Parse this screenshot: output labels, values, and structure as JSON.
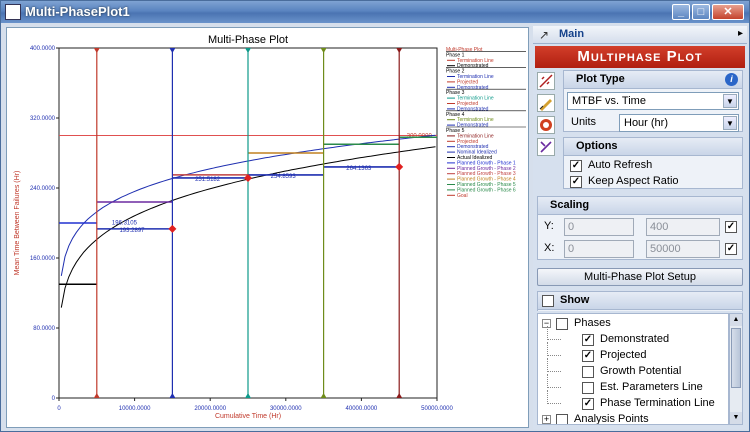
{
  "window": {
    "title": "Multi-PhasePlot1",
    "buttons": [
      "_",
      "□",
      "✕"
    ]
  },
  "panel": {
    "header": "Main",
    "banner": "Multiphase Plot",
    "plot_type": {
      "title": "Plot Type",
      "value": "MTBF vs. Time",
      "units_label": "Units",
      "units_value": "Hour (hr)"
    },
    "options": {
      "title": "Options",
      "items": [
        {
          "label": "Auto Refresh",
          "checked": true
        },
        {
          "label": "Keep Aspect Ratio",
          "checked": true
        }
      ]
    },
    "scaling": {
      "title": "Scaling",
      "y": {
        "label": "Y:",
        "min": "0",
        "max": "400",
        "checked": true
      },
      "x": {
        "label": "X:",
        "min": "0",
        "max": "50000",
        "checked": true
      }
    },
    "setup_button": "Multi-Phase Plot Setup",
    "show": {
      "title": "Show",
      "tree": [
        {
          "label": "Phases",
          "level": 0,
          "expander": "−",
          "checked": false
        },
        {
          "label": "Demonstrated",
          "level": 1,
          "checked": true
        },
        {
          "label": "Projected",
          "level": 1,
          "checked": true
        },
        {
          "label": "Growth Potential",
          "level": 1,
          "checked": false
        },
        {
          "label": "Est. Parameters Line",
          "level": 1,
          "checked": false
        },
        {
          "label": "Phase Termination Line",
          "level": 1,
          "checked": true
        },
        {
          "label": "Analysis Points",
          "level": 0,
          "expander": "+",
          "checked": false
        }
      ]
    }
  },
  "chart_data": {
    "type": "line",
    "title": "Multi-Phase Plot",
    "xlabel": "Cumulative Time (Hr)",
    "ylabel": "Mean Time Between Failures (Hr)",
    "xlim": [
      0,
      50000
    ],
    "ylim": [
      0,
      400
    ],
    "x_ticks": [
      "0",
      "10000.0000",
      "20000.0000",
      "30000.0000",
      "40000.0000",
      "50000.0000"
    ],
    "y_ticks": [
      "0",
      "80.0000",
      "160.0000",
      "240.0000",
      "320.0000",
      "400.0000"
    ],
    "goal": 300,
    "goal_label": "300.0000",
    "phase_terminations": [
      {
        "x": 5000,
        "color": "#c0392b"
      },
      {
        "x": 15000,
        "color": "#1f2fb0"
      },
      {
        "x": 25000,
        "color": "#0e9a8a"
      },
      {
        "x": 35000,
        "color": "#6e8c1a"
      },
      {
        "x": 45000,
        "color": "#8b1a1a"
      }
    ],
    "demonstrated": [
      {
        "x0": 0,
        "x1": 5000,
        "y": 130,
        "color": "#000000"
      },
      {
        "x0": 5000,
        "x1": 15000,
        "y": 193.3,
        "label": "193.2897",
        "color": "#1f2fb0"
      },
      {
        "x0": 15000,
        "x1": 25000,
        "y": 251.5,
        "label": "251.5182",
        "color": "#1f2fb0"
      },
      {
        "x0": 25000,
        "x1": 35000,
        "y": 254.9,
        "label": "254.8593",
        "color": "#1f2fb0"
      },
      {
        "x0": 35000,
        "x1": 45000,
        "y": 264.1,
        "label": "264.1363",
        "color": "#1f2fb0"
      }
    ],
    "planned_steps": [
      {
        "x0": 0,
        "x1": 5000,
        "y": 200,
        "color": "#2030d0"
      },
      {
        "x0": 5000,
        "x1": 15000,
        "y": 224,
        "color": "#6b2aa0"
      },
      {
        "x0": 15000,
        "x1": 25000,
        "y": 255,
        "color": "#c04040"
      },
      {
        "x0": 25000,
        "x1": 35000,
        "y": 280,
        "color": "#c08020"
      },
      {
        "x0": 35000,
        "x1": 45000,
        "y": 290,
        "color": "#2a8a4a"
      },
      {
        "x0": 45000,
        "x1": 50000,
        "y": 298,
        "color": "#2a8a4a"
      }
    ],
    "demo_label_extra": "196.3105",
    "projected_points": [
      {
        "x": 15000,
        "y": 193.3
      },
      {
        "x": 25000,
        "y": 251.5
      },
      {
        "x": 45000,
        "y": 264.1
      }
    ],
    "legend": [
      {
        "text": "Multi-Phase Plot",
        "color": "#c0392b"
      },
      {
        "text": "Phase 1",
        "color": "#000000"
      },
      {
        "text": "Termination Line",
        "color": "#c0392b"
      },
      {
        "text": "Demonstrated",
        "color": "#000000"
      },
      {
        "text": "Phase 2",
        "color": "#000000"
      },
      {
        "text": "Termination Line",
        "color": "#1f2fb0"
      },
      {
        "text": "Projected",
        "color": "#c0392b"
      },
      {
        "text": "Demonstrated",
        "color": "#1f2fb0"
      },
      {
        "text": "Phase 3",
        "color": "#000000"
      },
      {
        "text": "Termination Line",
        "color": "#0e9a8a"
      },
      {
        "text": "Projected",
        "color": "#c0392b"
      },
      {
        "text": "Demonstrated",
        "color": "#1f2fb0"
      },
      {
        "text": "Phase 4",
        "color": "#000000"
      },
      {
        "text": "Termination Line",
        "color": "#6e8c1a"
      },
      {
        "text": "Demonstrated",
        "color": "#1f2fb0"
      },
      {
        "text": "Phase 5",
        "color": "#000000"
      },
      {
        "text": "Termination Line",
        "color": "#8b1a1a"
      },
      {
        "text": "Projected",
        "color": "#c0392b"
      },
      {
        "text": "Demonstrated",
        "color": "#1f2fb0"
      },
      {
        "text": "Nominal Idealized",
        "color": "#1f2fb0"
      },
      {
        "text": "Actual Idealized",
        "color": "#000000"
      },
      {
        "text": "Planned Growth - Phase 1",
        "color": "#2030d0"
      },
      {
        "text": "Planned Growth - Phase 2",
        "color": "#6b2aa0"
      },
      {
        "text": "Planned Growth - Phase 3",
        "color": "#c04040"
      },
      {
        "text": "Planned Growth - Phase 4",
        "color": "#c08020"
      },
      {
        "text": "Planned Growth - Phase 5",
        "color": "#2a8a4a"
      },
      {
        "text": "Planned Growth - Phase 6",
        "color": "#2a8a4a"
      },
      {
        "text": "Goal",
        "color": "#c0392b"
      }
    ]
  }
}
